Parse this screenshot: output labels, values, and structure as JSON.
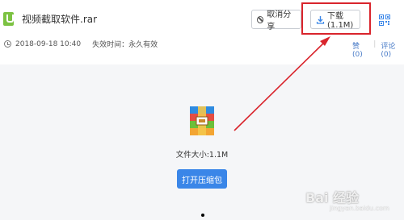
{
  "file": {
    "name": "视频截取软件.rar",
    "date": "2018-09-18 10:40",
    "expire_label": "失效时间：永久有效"
  },
  "actions": {
    "cancel_share": "取消分享",
    "download": "下载(1.1M)"
  },
  "social": {
    "like": "赞(0)",
    "divider": "|",
    "comment": "评论(0)"
  },
  "content": {
    "size_text": "文件大小:1.1M",
    "open_button": "打开压缩包"
  },
  "watermark": {
    "brand": "Bai 经验",
    "sub": "jingyan.baidu.com"
  },
  "colors": {
    "accent": "#3a86e8",
    "annotation": "#d9242c",
    "file_icon": "#7cc242"
  }
}
